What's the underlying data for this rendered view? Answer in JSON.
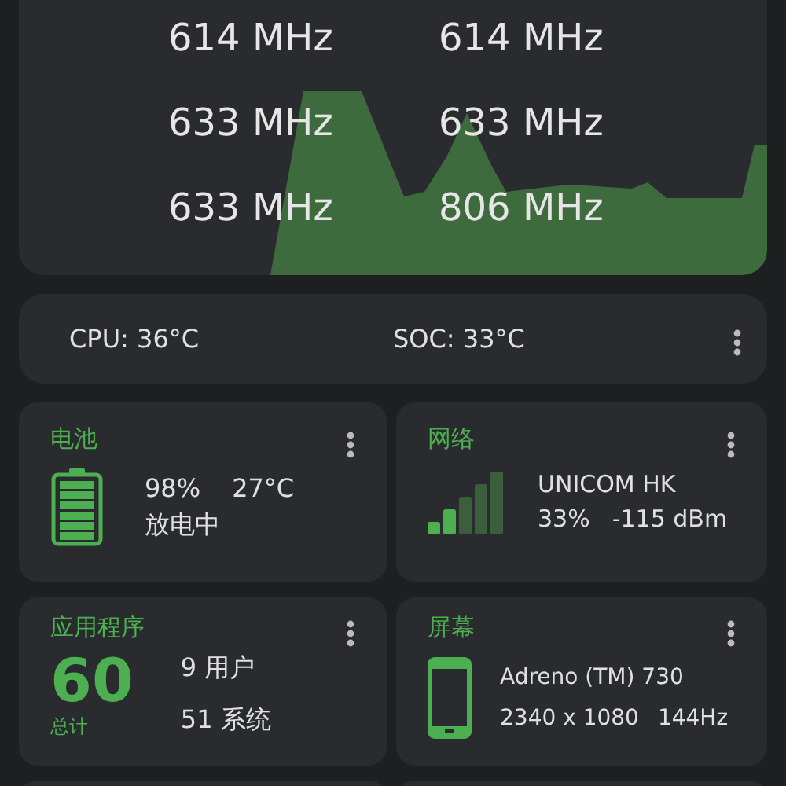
{
  "cpu_card": {
    "frequencies": [
      [
        "614 MHz",
        "614 MHz"
      ],
      [
        "633 MHz",
        "633 MHz"
      ],
      [
        "633 MHz",
        "806 MHz"
      ]
    ]
  },
  "temps_card": {
    "cpu": "CPU: 36°C",
    "soc": "SOC: 33°C"
  },
  "cards": [
    {
      "kind": "battery",
      "title": "电池",
      "level_text": "98%",
      "temp": "27°C",
      "status": "放电中"
    },
    {
      "kind": "network",
      "title": "网络",
      "carrier": "UNICOM HK",
      "signal": "33%",
      "dbm": "-115 dBm"
    },
    {
      "kind": "apps",
      "title": "应用程序",
      "total": "60",
      "total_label": "总计",
      "user": "9 用户",
      "system": "51 系统"
    },
    {
      "kind": "screen",
      "title": "屏幕",
      "gpu": "Adreno (TM) 730",
      "resolution": "2340 x 1080",
      "refresh": "144Hz"
    }
  ]
}
